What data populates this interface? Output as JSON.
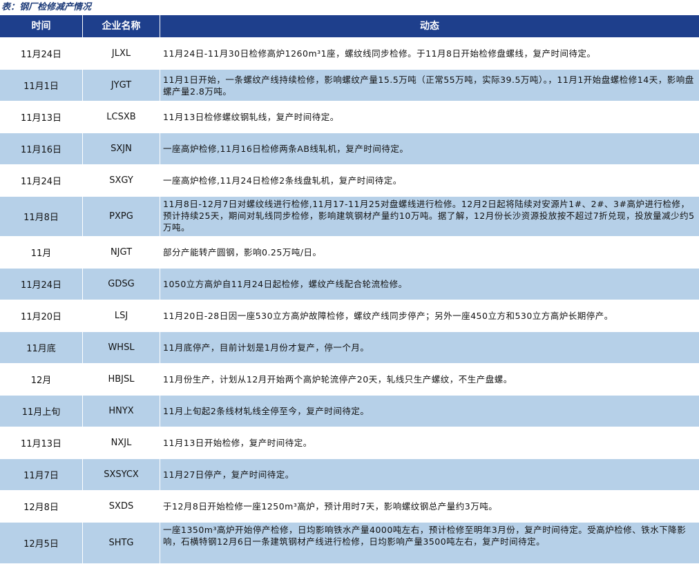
{
  "caption": "表：钢厂检修减产情况",
  "header": {
    "col_time": "时间",
    "col_company": "企业名称",
    "col_news": "动态"
  },
  "rows": [
    {
      "time": "11月24日",
      "company": "JLXL",
      "news": "11月24日-11月30日检修高炉1260m³1座，螺纹线同步检修。于11月8日开始检修盘螺线，复产时间待定。"
    },
    {
      "time": "11月1日",
      "company": "JYGT",
      "news": "11月1日开始，一条螺纹产线持续检修，影响螺纹产量15.5万吨（正常55万吨，实际39.5万吨）。，11月1开始盘螺检修14天，影响盘螺产量2.8万吨。"
    },
    {
      "time": "11月13日",
      "company": "LCSXB",
      "news": "11月13日检修螺纹钢轧线，复产时间待定。"
    },
    {
      "time": "11月16日",
      "company": "SXJN",
      "news": "一座高炉检修,11月16日检修两条AB线轧机，复产时间待定。"
    },
    {
      "time": "11月24日",
      "company": "SXGY",
      "news": "一座高炉检修,11月24日检修2条线盘轧机，复产时间待定。"
    },
    {
      "time": "11月8日",
      "company": "PXPG",
      "news": "11月8日-12月7日对螺纹线进行检修,11月17-11月25对盘螺线进行检修。12月2日起将陆续对安源片1#、2#、3#高炉进行检修，预计持续25天，期间对轧线同步检修，影响建筑钢材产量约10万吨。据了解，12月份长沙资源投放按不超过7折兑现，投放量减少约5万吨。"
    },
    {
      "time": "11月",
      "company": "NJGT",
      "news": "部分产能转产圆钢，影响0.25万吨/日。"
    },
    {
      "time": "11月24日",
      "company": "GDSG",
      "news": "1050立方高炉自11月24日起检修，螺纹产线配合轮流检修。"
    },
    {
      "time": "11月20日",
      "company": "LSJ",
      "news": "11月20日-28日因一座530立方高炉故障检修，螺纹产线同步停产；另外一座450立方和530立方高炉长期停产。"
    },
    {
      "time": "11月底",
      "company": "WHSL",
      "news": "11月底停产，目前计划是1月份才复产，停一个月。"
    },
    {
      "time": "12月",
      "company": "HBJSL",
      "news": "11月份生产，计划从12月开始两个高炉轮流停产20天，轧线只生产螺纹，不生产盘螺。"
    },
    {
      "time": "11月上旬",
      "company": "HNYX",
      "news": "11月上旬起2条线材轧线全停至今，复产时间待定。"
    },
    {
      "time": "11月13日",
      "company": "NXJL",
      "news": "11月13日开始检修，复产时间待定。"
    },
    {
      "time": "11月7日",
      "company": "SXSYCX",
      "news": "11月27日停产，复产时间待定。"
    },
    {
      "time": "12月8日",
      "company": "SXDS",
      "news": "于12月8日开始检修一座1250m³高炉，预计用时7天，影响螺纹钢总产量约3万吨。"
    },
    {
      "time": "12月5日",
      "company": "SHTG",
      "news": "一座1350m³高炉开始停产检修，日均影响铁水产量4000吨左右，预计检修至明年3月份，复产时间待定。受高炉检修、铁水下降影响，石横特钢12月6日一条建筑钢材产线进行检修，日均影响产量3500吨左右，复产时间待定。"
    }
  ]
}
